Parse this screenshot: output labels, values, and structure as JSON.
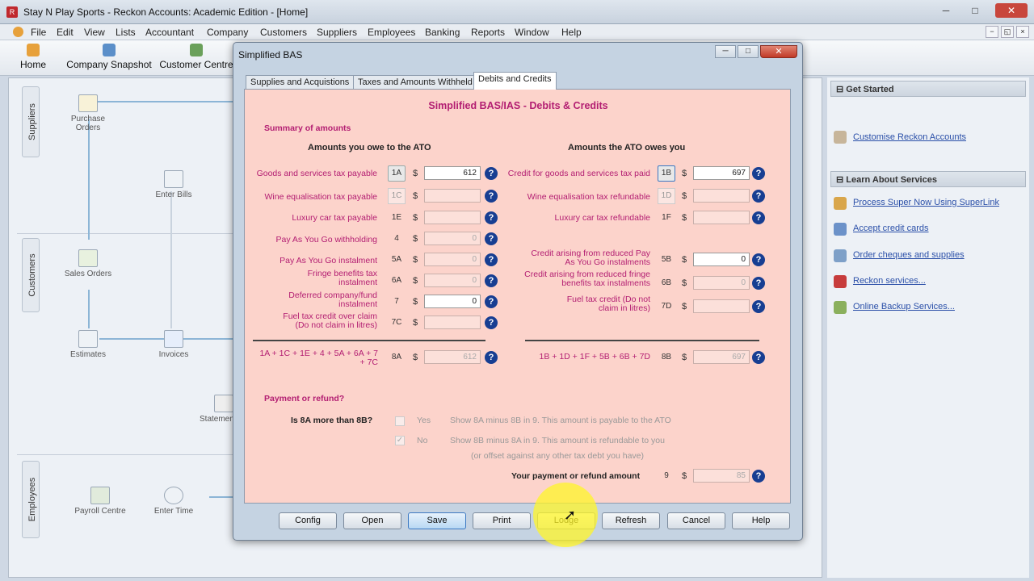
{
  "window": {
    "title": "Stay N Play Sports - Reckon Accounts: Academic Edition - [Home]",
    "minimize": "─",
    "maximize": "□",
    "close": "✕"
  },
  "menu": [
    "File",
    "Edit",
    "View",
    "Lists",
    "Accountant",
    "Company",
    "Customers",
    "Suppliers",
    "Employees",
    "Banking",
    "Reports",
    "Window",
    "Help"
  ],
  "mdi": [
    "−",
    "◱",
    "×"
  ],
  "toolbar": [
    "Home",
    "Company Snapshot",
    "Customer Centre"
  ],
  "home": {
    "tabs": [
      "Suppliers",
      "Customers",
      "Employees"
    ],
    "items": [
      "Purchase Orders",
      "Enter Bills",
      "Sales Orders",
      "Estimates",
      "Invoices",
      "Statement Charges",
      "Payroll Centre",
      "Enter Time"
    ]
  },
  "right_panel": {
    "get_started": "Get Started",
    "customise": "Customise Reckon Accounts",
    "learn": "Learn About Services",
    "links": [
      "Process Super Now Using SuperLink",
      "Accept credit cards",
      "Order cheques and supplies",
      "Reckon services...",
      "Online Backup Services..."
    ]
  },
  "dialog": {
    "title": "Simplified BAS",
    "min": "─",
    "max": "□",
    "close": "✕",
    "tabs": [
      "Supplies and Acquistions",
      "Taxes and Amounts Withheld",
      "Debits and Credits"
    ],
    "heading": "Simplified BAS/IAS - Debits & Credits",
    "summary": "Summary of amounts",
    "owe_head": "Amounts you owe to the ATO",
    "owed_head": "Amounts the ATO owes you",
    "left": [
      {
        "label": "Goods and services tax payable",
        "code": "1A",
        "value": "612"
      },
      {
        "label": "Wine equalisation tax payable",
        "code": "1C",
        "value": ""
      },
      {
        "label": "Luxury car tax payable",
        "code": "1E",
        "value": ""
      },
      {
        "label": "Pay As You Go withholding",
        "code": "4",
        "value": "0"
      },
      {
        "label": "Pay As You Go instalment",
        "code": "5A",
        "value": "0"
      },
      {
        "label": "Fringe benefits tax instalment",
        "code": "6A",
        "value": "0"
      },
      {
        "label": "Deferred company/fund instalment",
        "code": "7",
        "value": "0"
      },
      {
        "label": "Fuel tax credit over claim (Do not claim in litres)",
        "code": "7C",
        "value": ""
      }
    ],
    "right": [
      {
        "label": "Credit for goods and services tax paid",
        "code": "1B",
        "value": "697"
      },
      {
        "label": "Wine equalisation tax refundable",
        "code": "1D",
        "value": ""
      },
      {
        "label": "Luxury car tax refundable",
        "code": "1F",
        "value": ""
      },
      {
        "label": "Credit arising from reduced Pay As You Go instalments",
        "code": "5B",
        "value": "0"
      },
      {
        "label": "Credit arising from reduced fringe benefits tax instalments",
        "code": "6B",
        "value": "0"
      },
      {
        "label": "Fuel tax credit (Do not claim in litres)",
        "code": "7D",
        "value": ""
      }
    ],
    "sum_left": {
      "label": "1A + 1C + 1E + 4 + 5A + 6A + 7 + 7C",
      "code": "8A",
      "value": "612"
    },
    "sum_right": {
      "label": "1B + 1D + 1F + 5B + 6B + 7D",
      "code": "8B",
      "value": "697"
    },
    "payment": "Payment or refund?",
    "question": "Is 8A more than 8B?",
    "yes": "Yes",
    "no": "No",
    "yes_text": "Show 8A minus 8B in 9. This amount is payable to the ATO",
    "no_text": "Show 8B minus 8A in 9. This amount is refundable to you",
    "no_text2": "(or offset against any other tax debt you have)",
    "total_label": "Your payment or refund amount",
    "total_code": "9",
    "total_value": "85",
    "dollar": "$",
    "help": "?",
    "check": "✓",
    "buttons": [
      "Config",
      "Open",
      "Save",
      "Print",
      "Lodge",
      "Refresh",
      "Cancel",
      "Help"
    ]
  }
}
